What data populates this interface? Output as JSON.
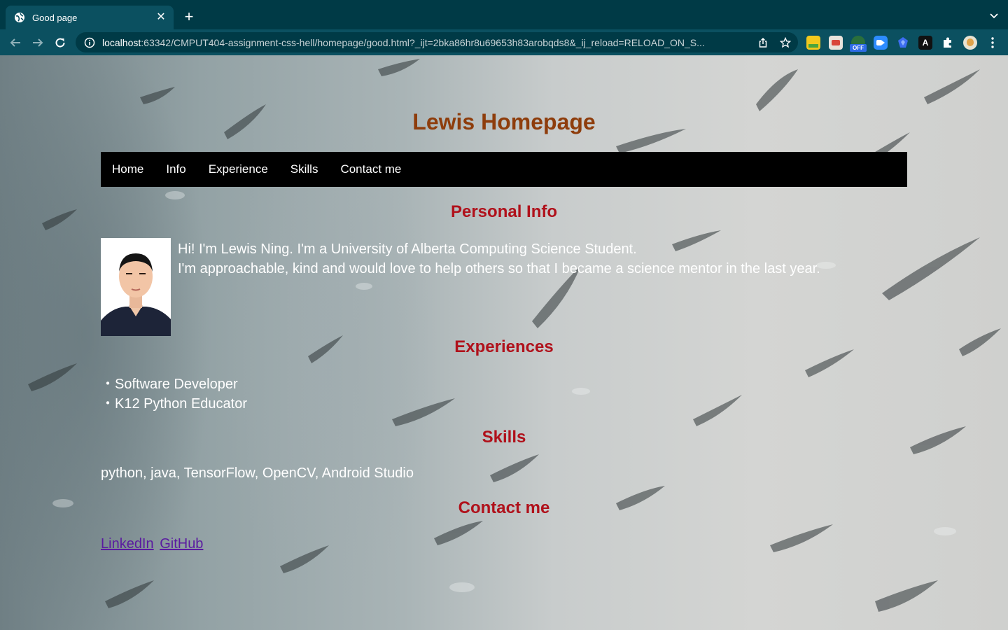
{
  "browser": {
    "tab_title": "Good page",
    "url_host": "localhost",
    "url_rest": ":63342/CMPUT404-assignment-css-hell/homepage/good.html?_ijt=2bka86hr8u69653h83arobqds8&_ij_reload=RELOAD_ON_S...",
    "icons": [
      "globe-icon",
      "close-icon",
      "plus-icon",
      "chevron-down-icon",
      "back-arrow-icon",
      "forward-arrow-icon",
      "reload-icon",
      "info-icon",
      "share-icon",
      "star-icon",
      "extensions-puzzle-icon",
      "kebab-menu-icon"
    ],
    "extension_badge": "OFF"
  },
  "page": {
    "title": "Lewis Homepage",
    "nav": [
      "Home",
      "Info",
      "Experience",
      "Skills",
      "Contact me"
    ],
    "sections": {
      "info_heading": "Personal Info",
      "intro_line1": "Hi! I'm Lewis Ning. I'm a University of Alberta Computing Science Student.",
      "intro_line2": "I'm approachable, kind and would love to help others so that I became a science mentor in the last year.",
      "experience_heading": "Experiences",
      "experiences": [
        "Software Developer",
        "K12 Python Educator"
      ],
      "skills_heading": "Skills",
      "skills_text": "python, java, TensorFlow, OpenCV, Android Studio",
      "contact_heading": "Contact me",
      "links": [
        "LinkedIn",
        "GitHub"
      ]
    },
    "colors": {
      "title": "#8e3d0c",
      "heading": "#b0111b",
      "navbar": "#000000",
      "visited_link": "#5a1aa0"
    }
  }
}
